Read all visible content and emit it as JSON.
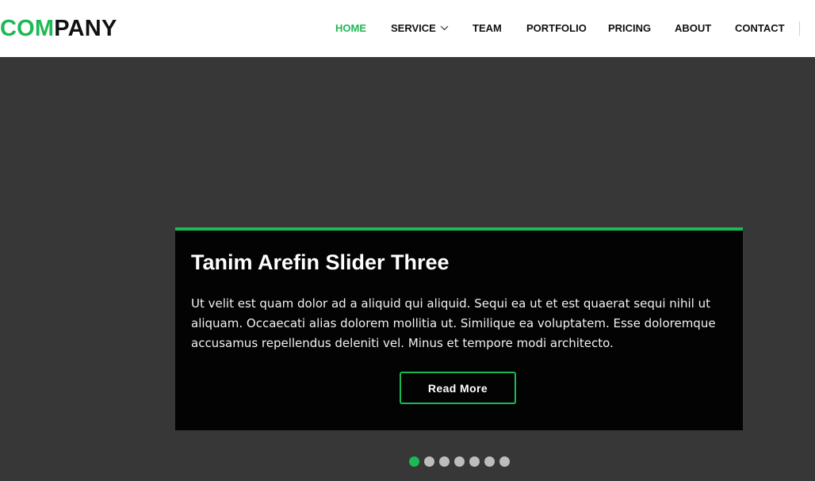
{
  "brand": {
    "accent_text": "COM",
    "rest_text": "PANY",
    "accent_color": "#1db954"
  },
  "nav": {
    "items": [
      {
        "label": "HOME",
        "active": true
      },
      {
        "label": "SERVICE",
        "has_dropdown": true
      },
      {
        "label": "TEAM"
      },
      {
        "label": "PORTFOLIO"
      },
      {
        "label": "PRICING"
      },
      {
        "label": "ABOUT"
      },
      {
        "label": "CONTACT"
      }
    ]
  },
  "slider": {
    "title": "Tanim Arefin Slider Three",
    "text": "Ut velit est quam dolor ad a aliquid qui aliquid. Sequi ea ut et est quaerat sequi nihil ut aliquam. Occaecati alias dolorem mollitia ut. Similique ea voluptatem. Esse doloremque accusamus repellendus deleniti vel. Minus et tempore modi architecto.",
    "button_label": "Read More",
    "dots_total": 7,
    "active_dot": 1
  },
  "colors": {
    "accent": "#1db954",
    "hero_bg": "#373737",
    "box_bg": "#030303"
  },
  "icons": {
    "dropdown": "chevron-down-icon"
  }
}
